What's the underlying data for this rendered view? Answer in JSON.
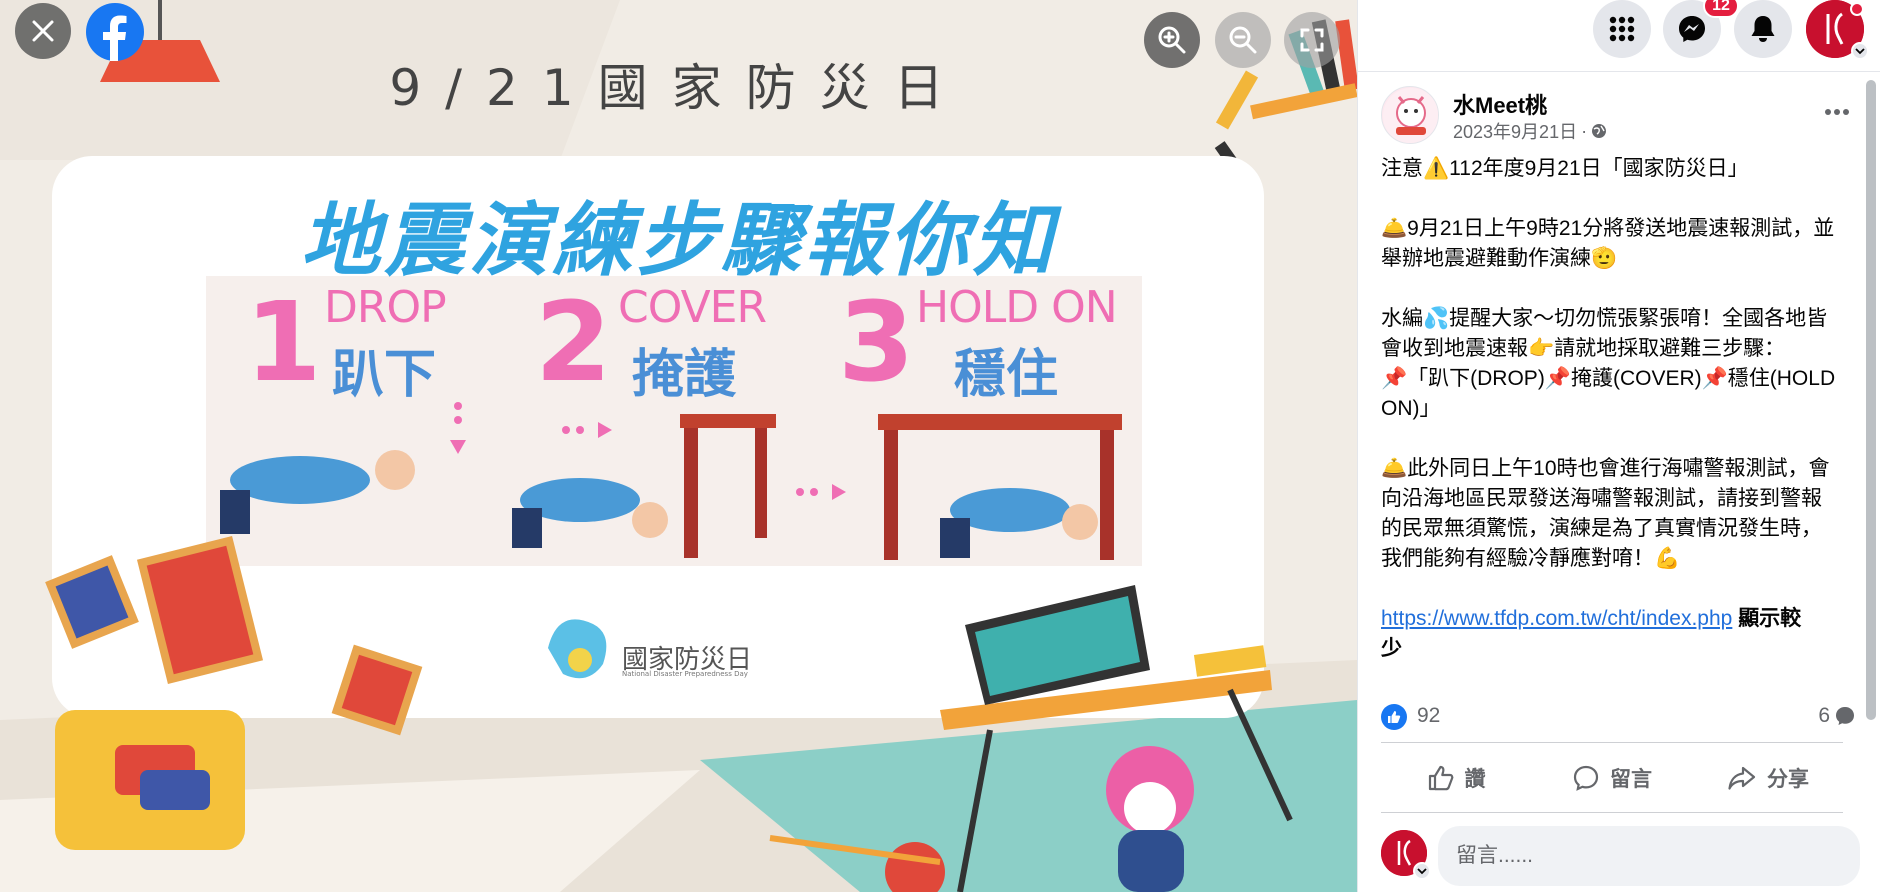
{
  "viewer": {
    "poster": {
      "top_title": "9/21國家防災日",
      "main_title": "地震演練步驟報你知",
      "steps": [
        {
          "num": "1",
          "en": "DROP",
          "zh": "趴下"
        },
        {
          "num": "2",
          "en": "COVER",
          "zh": "掩護"
        },
        {
          "num": "3",
          "en": "HOLD ON",
          "zh": "穩住"
        }
      ],
      "logo_text": "國家防災日",
      "logo_subtext": "National Disaster Preparedness Day"
    },
    "controls": {
      "close_icon": "close-icon",
      "facebook_icon": "facebook-logo-icon",
      "zoom_in_icon": "zoom-in-icon",
      "zoom_out_icon": "zoom-out-icon",
      "fullscreen_icon": "fullscreen-icon"
    }
  },
  "topbar": {
    "notification_badge": "12",
    "icons": [
      "menu-grid-icon",
      "messenger-icon",
      "bell-icon",
      "profile-avatar"
    ]
  },
  "post": {
    "page_name": "水Meet桃",
    "date": "2023年9月21日",
    "separator": "·",
    "privacy_icon": "globe-icon",
    "body": {
      "p1": "注意⚠️112年度9月21日「國家防災日」",
      "p2_l1": "🛎️9月21日上午9時21分將發送地震速報測試，並",
      "p2_l2": "舉辦地震避難動作演練🫡",
      "p3_l1": "水編💦提醒大家～切勿慌張緊張唷！全國各地皆",
      "p3_l2": "會收到地震速報👉請就地採取避難三步驟：",
      "p3_l3": "📌「趴下(DROP)📌掩護(COVER)📌穩住(HOLD",
      "p3_l4": "ON)」",
      "p4_l1": "🛎️此外同日上午10時也會進行海嘯警報測試，會",
      "p4_l2": "向沿海地區民眾發送海嘯警報測試，請接到警報",
      "p4_l3": "的民眾無須驚慌，演練是為了真實情況發生時，",
      "p4_l4": "我們能夠有經驗冷靜應對唷！💪",
      "link": "https://www.tfdp.com.tw/cht/index.php",
      "show_less_1": "顯示較",
      "show_less_2": "少"
    },
    "reactions": {
      "likes": "92",
      "comments": "6"
    },
    "actions": {
      "like": "讚",
      "comment": "留言",
      "share": "分享"
    },
    "comment_input": {
      "placeholder": "留言......"
    }
  },
  "colors": {
    "facebook_blue": "#1877f2",
    "link_blue": "#216fdb",
    "badge_red": "#e41e3f",
    "poster_title_blue": "#2fa3e0",
    "poster_pink": "#ef6eb4"
  }
}
